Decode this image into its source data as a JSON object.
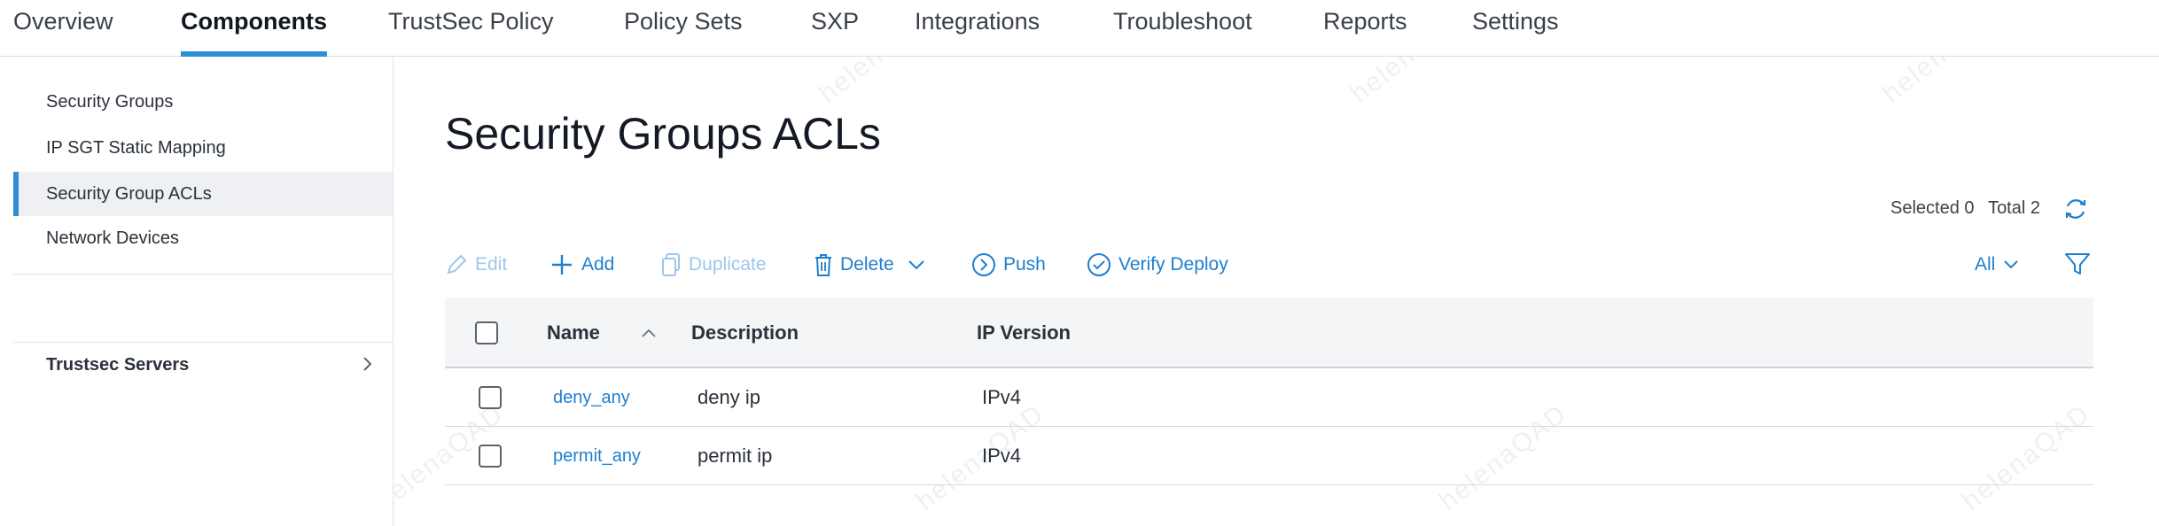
{
  "topnav": {
    "tabs": [
      {
        "label": "Overview"
      },
      {
        "label": "Components"
      },
      {
        "label": "TrustSec Policy"
      },
      {
        "label": "Policy Sets"
      },
      {
        "label": "SXP"
      },
      {
        "label": "Integrations"
      },
      {
        "label": "Troubleshoot"
      },
      {
        "label": "Reports"
      },
      {
        "label": "Settings"
      }
    ],
    "active_tab": "Components"
  },
  "sidebar": {
    "items": [
      {
        "label": "Security Groups"
      },
      {
        "label": "IP SGT Static Mapping"
      },
      {
        "label": "Security Group ACLs"
      },
      {
        "label": "Network Devices"
      }
    ],
    "active_item": "Security Group ACLs",
    "group": {
      "label": "Trustsec Servers"
    }
  },
  "main": {
    "title": "Security Groups ACLs",
    "selected_label": "Selected 0",
    "total_label": "Total 2",
    "toolbar": {
      "edit": "Edit",
      "add": "Add",
      "duplicate": "Duplicate",
      "delete": "Delete",
      "push": "Push",
      "verify_deploy": "Verify Deploy",
      "filter_all": "All"
    },
    "table": {
      "columns": [
        "Name",
        "Description",
        "IP Version"
      ],
      "rows": [
        {
          "name": "deny_any",
          "description": "deny ip",
          "ip_version": "IPv4"
        },
        {
          "name": "permit_any",
          "description": "permit ip",
          "ip_version": "IPv4"
        }
      ]
    }
  },
  "colors": {
    "accent": "#2f8fd6",
    "link": "#1e7fcf",
    "disabled_link": "#9fc6ea"
  },
  "watermark": {
    "text": "helenaQAD"
  }
}
